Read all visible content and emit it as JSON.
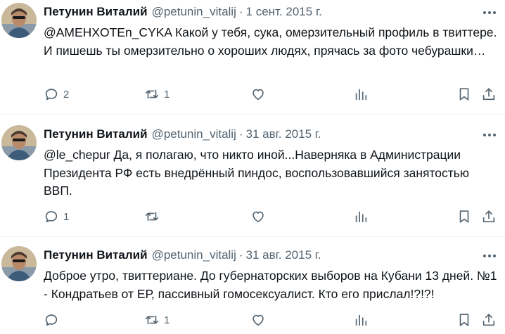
{
  "tweets": [
    {
      "name": "Петунин Виталий",
      "handle": "@petunin_vitalij",
      "separator": "·",
      "date": "1 сент. 2015 г.",
      "text": "@AMEHXOTEn_CYKA Какой у тебя, сука, омерзительный профиль в твиттере. И пишешь ты омерзительно о хороших людях, прячась за фото чебурашки…",
      "replies": "2",
      "retweets": "1",
      "likes": ""
    },
    {
      "name": "Петунин Виталий",
      "handle": "@petunin_vitalij",
      "separator": "·",
      "date": "31 авг. 2015 г.",
      "text": "@le_chepur Да, я полагаю, что никто иной...Наверняка в Администрации Президента РФ есть внедрённый пиндос, воспользовавшийся занятостью ВВП.",
      "replies": "1",
      "retweets": "",
      "likes": ""
    },
    {
      "name": "Петунин Виталий",
      "handle": "@petunin_vitalij",
      "separator": "·",
      "date": "31 авг. 2015 г.",
      "text": "Доброе утро, твиттериане. До губернаторских выборов на Кубани 13 дней. №1 - Кондратьев от ЕР, пассивный гомосексуалист. Кто его прислал!?!?!",
      "replies": "",
      "retweets": "1",
      "likes": ""
    }
  ]
}
